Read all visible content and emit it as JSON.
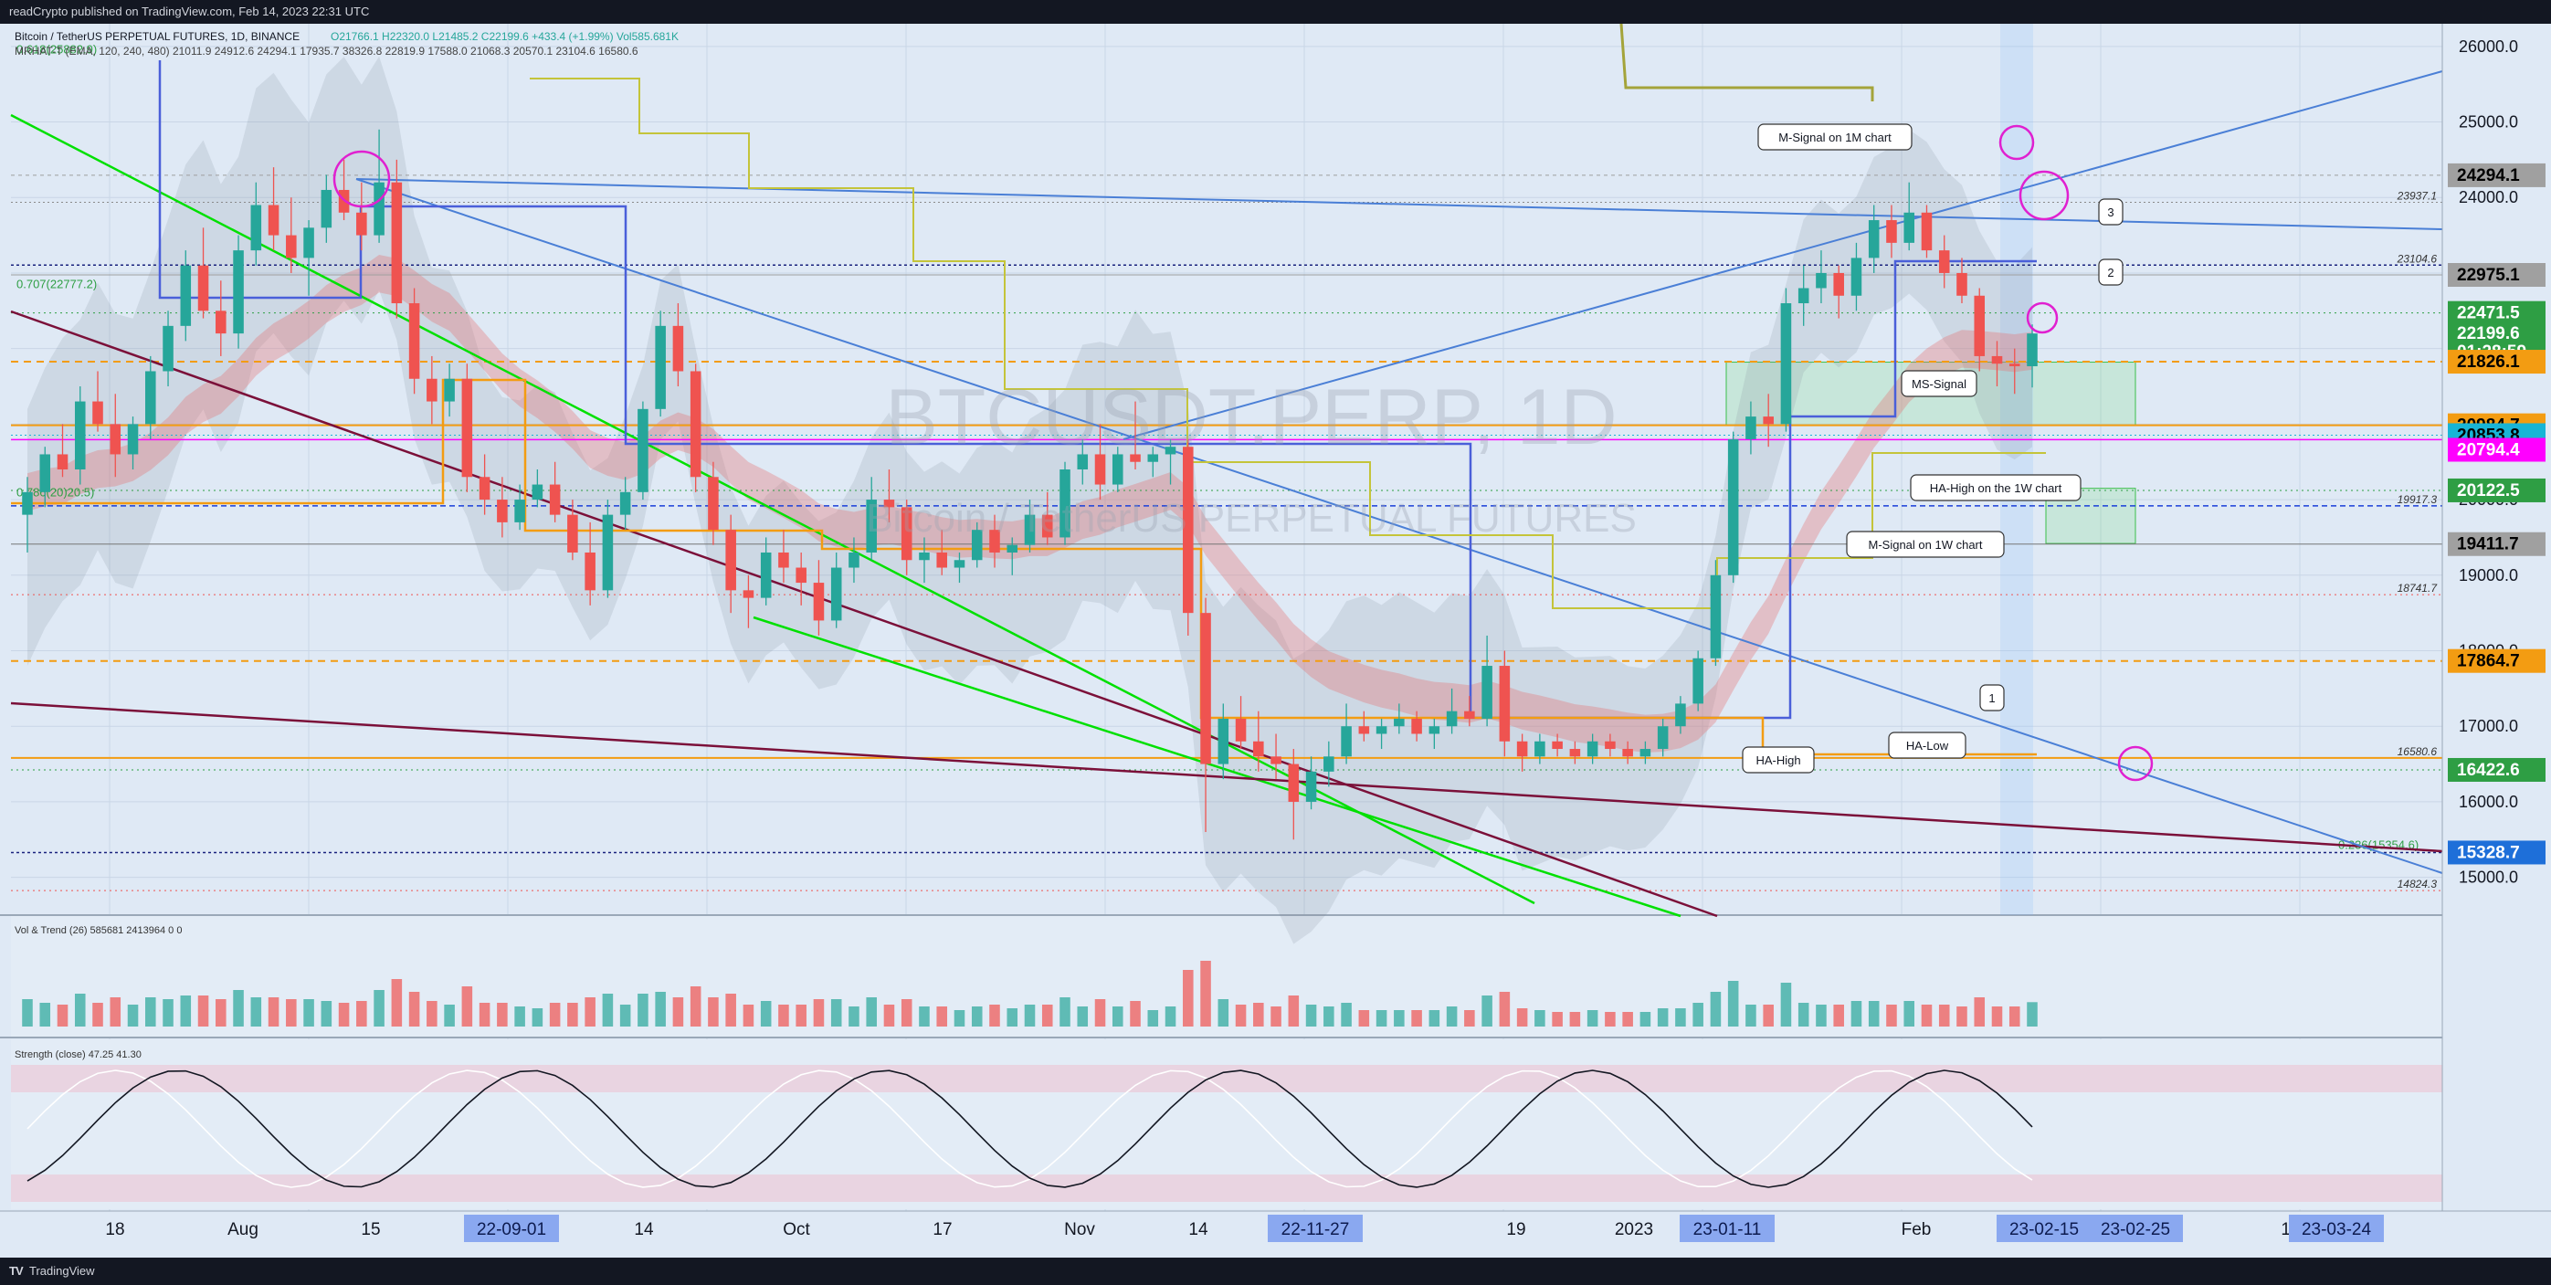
{
  "header": {
    "published": "readCrypto published on TradingView.com, Feb 14, 2023 22:31 UTC"
  },
  "footer": {
    "logo": "TV",
    "brand": "TradingView"
  },
  "colors": {
    "background": "#dfe9f5",
    "up": "#26a69a",
    "down": "#ef5350",
    "grid": "#c9d6e6"
  },
  "chart_data": {
    "type": "candlestick",
    "symbol_line": "Bitcoin / TetherUS PERPETUAL FUTURES, 1D, BINANCE",
    "ohlc_line": "O21766.1  H22320.0  L21485.2  C22199.6  +433.4 (+1.99%)  Vol585.681K",
    "indicator_line": "MRHAT-T (EMA, 120, 240, 480)  21011.9  24912.6  24294.1  17935.7  38326.8  22819.9  17588.0  21068.3  20570.1  23104.6  16580.6",
    "watermark_symbol": "BTCUSDT.PERP, 1D",
    "watermark_desc": "Bitcoin / TetherUS PERPETUAL FUTURES",
    "ylim": [
      14500,
      26300
    ],
    "y_ticks": [
      "26000.0",
      "25000.0",
      "24000.0",
      "23000.0",
      "22000.0",
      "21000.0",
      "20000.0",
      "19000.0",
      "18000.0",
      "17000.0",
      "16000.0",
      "15000.0"
    ],
    "x_labels": [
      "18",
      "Aug",
      "15",
      "14",
      "Oct",
      "17",
      "Nov",
      "14",
      "19",
      "2023",
      "Feb",
      "14"
    ],
    "x_highlight_labels": [
      "22-09-01",
      "22-11-27",
      "23-01-11",
      "23-02-15",
      "23-02-25",
      "23-03-24"
    ],
    "price_tags": [
      {
        "value": "24294.1",
        "bg": "#a0a0a0",
        "fg": "#000000"
      },
      {
        "value": "22975.1",
        "bg": "#a0a0a0",
        "fg": "#000000"
      },
      {
        "value": "22471.5",
        "bg": "#2e9e44",
        "fg": "#ffffff"
      },
      {
        "value": "22199.6",
        "bg": "#2e9e44",
        "fg": "#ffffff"
      },
      {
        "value": "01:28:59",
        "bg": "#2e9e44",
        "fg": "#ffffff"
      },
      {
        "value": "21826.1",
        "bg": "#f39c12",
        "fg": "#000000"
      },
      {
        "value": "20984.7",
        "bg": "#f39c12",
        "fg": "#000000"
      },
      {
        "value": "20853.8",
        "bg": "#18b4d6",
        "fg": "#000000"
      },
      {
        "value": "20794.4",
        "bg": "#ff00ff",
        "fg": "#ffffff"
      },
      {
        "value": "20122.5",
        "bg": "#2e9e44",
        "fg": "#ffffff"
      },
      {
        "value": "19411.7",
        "bg": "#a0a0a0",
        "fg": "#000000"
      },
      {
        "value": "17864.7",
        "bg": "#f39c12",
        "fg": "#000000"
      },
      {
        "value": "16422.6",
        "bg": "#2e9e44",
        "fg": "#ffffff"
      },
      {
        "value": "15328.7",
        "bg": "#1e6fd9",
        "fg": "#ffffff"
      }
    ],
    "level_texts": [
      {
        "price": 23937.1,
        "text": "23937.1"
      },
      {
        "price": 23104.6,
        "text": "23104.6"
      },
      {
        "price": 19917.3,
        "text": "19917.3"
      },
      {
        "price": 18741.7,
        "text": "18741.7"
      },
      {
        "price": 16580.6,
        "text": "16580.6"
      },
      {
        "price": 14824.3,
        "text": "14824.3"
      }
    ],
    "fib_labels": [
      "0.618(25882.9)",
      "0.707(22777.2)",
      "0.786(20)20.5)",
      "0.236(15354.6)"
    ],
    "annotations": [
      "M-Signal on 1M chart",
      "MS-Signal",
      "HA-High on the 1W chart",
      "M-Signal on 1W chart",
      "HA-High",
      "HA-Low",
      "1",
      "2",
      "3"
    ],
    "candles": [
      [
        19800,
        20300,
        19300,
        20100
      ],
      [
        20100,
        20700,
        19900,
        20600
      ],
      [
        20600,
        21000,
        20300,
        20400
      ],
      [
        20400,
        21500,
        20200,
        21300
      ],
      [
        21300,
        21700,
        20900,
        21000
      ],
      [
        21000,
        21400,
        20300,
        20600
      ],
      [
        20600,
        21100,
        20400,
        21000
      ],
      [
        21000,
        21900,
        20800,
        21700
      ],
      [
        21700,
        22500,
        21500,
        22300
      ],
      [
        22300,
        23300,
        22100,
        23100
      ],
      [
        23100,
        23600,
        22400,
        22500
      ],
      [
        22500,
        22900,
        21900,
        22200
      ],
      [
        22200,
        23500,
        22000,
        23300
      ],
      [
        23300,
        24200,
        23100,
        23900
      ],
      [
        23900,
        24400,
        23300,
        23500
      ],
      [
        23500,
        24000,
        23000,
        23200
      ],
      [
        23200,
        23700,
        22700,
        23600
      ],
      [
        23600,
        24300,
        23400,
        24100
      ],
      [
        24100,
        24500,
        23700,
        23800
      ],
      [
        23800,
        24200,
        23300,
        23500
      ],
      [
        23500,
        24900,
        23400,
        24200
      ],
      [
        24200,
        24500,
        22400,
        22600
      ],
      [
        22600,
        22800,
        21400,
        21600
      ],
      [
        21600,
        21900,
        21000,
        21300
      ],
      [
        21300,
        21800,
        21100,
        21600
      ],
      [
        21600,
        21800,
        20100,
        20300
      ],
      [
        20300,
        20600,
        19800,
        20000
      ],
      [
        20000,
        20300,
        19500,
        19700
      ],
      [
        19700,
        20200,
        19600,
        20000
      ],
      [
        20000,
        20400,
        19900,
        20200
      ],
      [
        20200,
        20500,
        19700,
        19800
      ],
      [
        19800,
        20000,
        19200,
        19300
      ],
      [
        19300,
        19700,
        18600,
        18800
      ],
      [
        18800,
        20000,
        18700,
        19800
      ],
      [
        19800,
        20300,
        19600,
        20100
      ],
      [
        20100,
        21300,
        20000,
        21200
      ],
      [
        21200,
        22500,
        21100,
        22300
      ],
      [
        22300,
        22600,
        21500,
        21700
      ],
      [
        21700,
        21800,
        20100,
        20300
      ],
      [
        20300,
        20500,
        19400,
        19600
      ],
      [
        19600,
        19800,
        18500,
        18800
      ],
      [
        18800,
        19000,
        18300,
        18700
      ],
      [
        18700,
        19500,
        18600,
        19300
      ],
      [
        19300,
        19600,
        18900,
        19100
      ],
      [
        19100,
        19300,
        18600,
        18900
      ],
      [
        18900,
        19200,
        18200,
        18400
      ],
      [
        18400,
        19300,
        18300,
        19100
      ],
      [
        19100,
        19500,
        18900,
        19300
      ],
      [
        19300,
        20300,
        19200,
        20000
      ],
      [
        20000,
        20400,
        19700,
        19900
      ],
      [
        19900,
        20000,
        19000,
        19200
      ],
      [
        19200,
        19500,
        18900,
        19300
      ],
      [
        19300,
        19600,
        19000,
        19100
      ],
      [
        19100,
        19300,
        18900,
        19200
      ],
      [
        19200,
        19700,
        19100,
        19600
      ],
      [
        19600,
        19800,
        19100,
        19300
      ],
      [
        19300,
        19500,
        19000,
        19400
      ],
      [
        19400,
        20000,
        19300,
        19800
      ],
      [
        19800,
        20100,
        19400,
        19500
      ],
      [
        19500,
        20500,
        19400,
        20400
      ],
      [
        20400,
        20800,
        20200,
        20600
      ],
      [
        20600,
        21000,
        20000,
        20200
      ],
      [
        20200,
        20700,
        20100,
        20600
      ],
      [
        20600,
        21300,
        20400,
        20500
      ],
      [
        20500,
        20700,
        20300,
        20600
      ],
      [
        20600,
        20800,
        20200,
        20700
      ],
      [
        20700,
        20800,
        18200,
        18500
      ],
      [
        18500,
        18700,
        15600,
        16500
      ],
      [
        16500,
        17300,
        16300,
        17100
      ],
      [
        17100,
        17400,
        16700,
        16800
      ],
      [
        16800,
        17200,
        16400,
        16600
      ],
      [
        16600,
        16900,
        16300,
        16500
      ],
      [
        16500,
        16700,
        15500,
        16000
      ],
      [
        16000,
        16600,
        15900,
        16400
      ],
      [
        16400,
        16800,
        16200,
        16600
      ],
      [
        16600,
        17300,
        16500,
        17000
      ],
      [
        17000,
        17200,
        16800,
        16900
      ],
      [
        16900,
        17100,
        16700,
        17000
      ],
      [
        17000,
        17300,
        16900,
        17100
      ],
      [
        17100,
        17200,
        16800,
        16900
      ],
      [
        16900,
        17100,
        16700,
        17000
      ],
      [
        17000,
        17500,
        16900,
        17200
      ],
      [
        17200,
        17400,
        17000,
        17100
      ],
      [
        17100,
        18200,
        17000,
        17800
      ],
      [
        17800,
        18000,
        16600,
        16800
      ],
      [
        16800,
        16900,
        16400,
        16600
      ],
      [
        16600,
        16900,
        16500,
        16800
      ],
      [
        16800,
        16900,
        16600,
        16700
      ],
      [
        16700,
        16800,
        16500,
        16600
      ],
      [
        16600,
        16900,
        16500,
        16800
      ],
      [
        16800,
        16900,
        16600,
        16700
      ],
      [
        16700,
        16800,
        16500,
        16600
      ],
      [
        16600,
        16800,
        16500,
        16700
      ],
      [
        16700,
        17100,
        16600,
        17000
      ],
      [
        17000,
        17400,
        16900,
        17300
      ],
      [
        17300,
        18000,
        17200,
        17900
      ],
      [
        17900,
        19200,
        17800,
        19000
      ],
      [
        19000,
        20900,
        18900,
        20800
      ],
      [
        20800,
        21300,
        20600,
        21100
      ],
      [
        21100,
        21400,
        20700,
        21000
      ],
      [
        21000,
        22800,
        20900,
        22600
      ],
      [
        22600,
        23100,
        22300,
        22800
      ],
      [
        22800,
        23300,
        22600,
        23000
      ],
      [
        23000,
        23100,
        22400,
        22700
      ],
      [
        22700,
        23400,
        22500,
        23200
      ],
      [
        23200,
        23900,
        23000,
        23700
      ],
      [
        23700,
        23900,
        23200,
        23400
      ],
      [
        23400,
        24200,
        23300,
        23800
      ],
      [
        23800,
        23900,
        23200,
        23300
      ],
      [
        23300,
        23500,
        22800,
        23000
      ],
      [
        23000,
        23200,
        22600,
        22700
      ],
      [
        22700,
        22800,
        21700,
        21900
      ],
      [
        21900,
        22100,
        21500,
        21800
      ],
      [
        21800,
        22000,
        21400,
        21766
      ],
      [
        21766,
        22320,
        21485,
        22199.6
      ]
    ],
    "volume_panel": {
      "label": "Vol & Trend (26)",
      "values": [
        "585681",
        "2413964",
        "0",
        "0"
      ],
      "ticks": [
        "5000000",
        "2500000",
        "0"
      ]
    },
    "strength_panel": {
      "label": "Strength (close)",
      "values": [
        "47.25",
        "41.30"
      ],
      "ticks": [
        "80.00",
        "40.00",
        "0.00"
      ]
    }
  }
}
